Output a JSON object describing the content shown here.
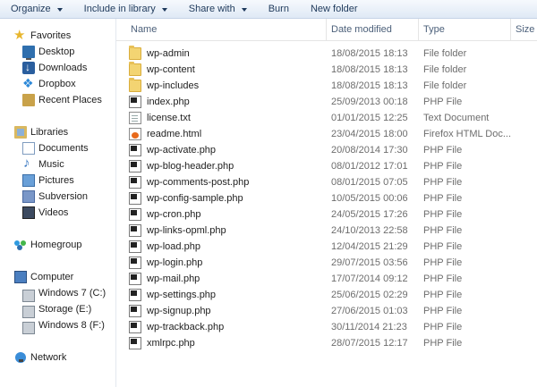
{
  "toolbar": {
    "organize": "Organize",
    "include_in_library": "Include in library",
    "share_with": "Share with",
    "burn": "Burn",
    "new_folder": "New folder"
  },
  "nav": {
    "favorites": "Favorites",
    "favorites_items": [
      "Desktop",
      "Downloads",
      "Dropbox",
      "Recent Places"
    ],
    "libraries": "Libraries",
    "library_items": [
      "Documents",
      "Music",
      "Pictures",
      "Subversion",
      "Videos"
    ],
    "homegroup": "Homegroup",
    "computer": "Computer",
    "computer_items": [
      "Windows 7 (C:)",
      "Storage (E:)",
      "Windows 8 (F:)"
    ],
    "network": "Network"
  },
  "columns": {
    "name": "Name",
    "date_modified": "Date modified",
    "type": "Type",
    "size": "Size"
  },
  "files": [
    {
      "name": "wp-admin",
      "date": "18/08/2015 18:13",
      "type": "File folder",
      "icon": "folder"
    },
    {
      "name": "wp-content",
      "date": "18/08/2015 18:13",
      "type": "File folder",
      "icon": "folder"
    },
    {
      "name": "wp-includes",
      "date": "18/08/2015 18:13",
      "type": "File folder",
      "icon": "folder"
    },
    {
      "name": "index.php",
      "date": "25/09/2013 00:18",
      "type": "PHP File",
      "icon": "php"
    },
    {
      "name": "license.txt",
      "date": "01/01/2015 12:25",
      "type": "Text Document",
      "icon": "txt"
    },
    {
      "name": "readme.html",
      "date": "23/04/2015 18:00",
      "type": "Firefox HTML Doc...",
      "icon": "html"
    },
    {
      "name": "wp-activate.php",
      "date": "20/08/2014 17:30",
      "type": "PHP File",
      "icon": "php"
    },
    {
      "name": "wp-blog-header.php",
      "date": "08/01/2012 17:01",
      "type": "PHP File",
      "icon": "php"
    },
    {
      "name": "wp-comments-post.php",
      "date": "08/01/2015 07:05",
      "type": "PHP File",
      "icon": "php"
    },
    {
      "name": "wp-config-sample.php",
      "date": "10/05/2015 00:06",
      "type": "PHP File",
      "icon": "php"
    },
    {
      "name": "wp-cron.php",
      "date": "24/05/2015 17:26",
      "type": "PHP File",
      "icon": "php"
    },
    {
      "name": "wp-links-opml.php",
      "date": "24/10/2013 22:58",
      "type": "PHP File",
      "icon": "php"
    },
    {
      "name": "wp-load.php",
      "date": "12/04/2015 21:29",
      "type": "PHP File",
      "icon": "php"
    },
    {
      "name": "wp-login.php",
      "date": "29/07/2015 03:56",
      "type": "PHP File",
      "icon": "php"
    },
    {
      "name": "wp-mail.php",
      "date": "17/07/2014 09:12",
      "type": "PHP File",
      "icon": "php"
    },
    {
      "name": "wp-settings.php",
      "date": "25/06/2015 02:29",
      "type": "PHP File",
      "icon": "php"
    },
    {
      "name": "wp-signup.php",
      "date": "27/06/2015 01:03",
      "type": "PHP File",
      "icon": "php"
    },
    {
      "name": "wp-trackback.php",
      "date": "30/11/2014 21:23",
      "type": "PHP File",
      "icon": "php"
    },
    {
      "name": "xmlrpc.php",
      "date": "28/07/2015 12:17",
      "type": "PHP File",
      "icon": "php"
    }
  ]
}
